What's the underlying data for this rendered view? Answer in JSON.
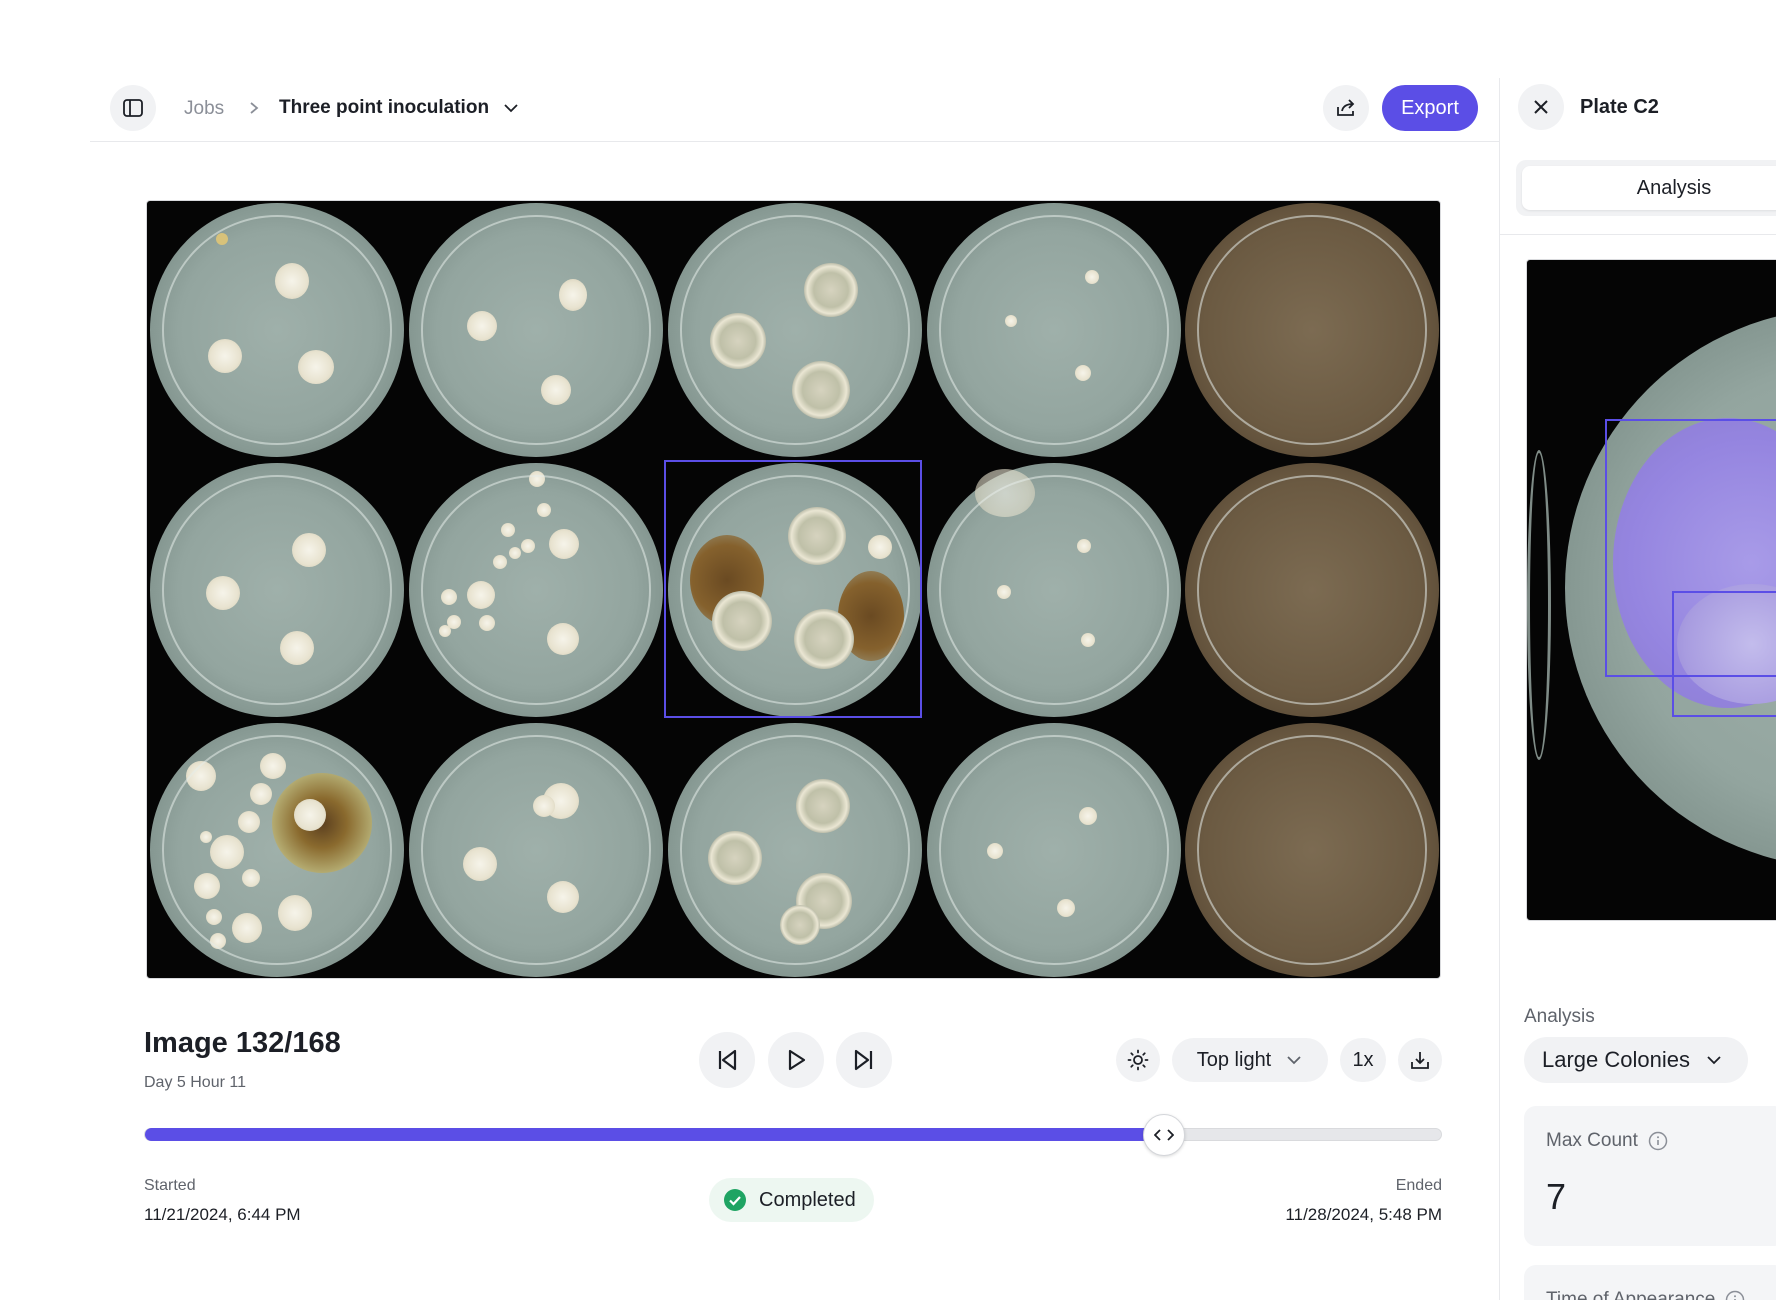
{
  "header": {
    "breadcrumb_root": "Jobs",
    "job_name": "Three point inoculation",
    "export_label": "Export"
  },
  "viewer": {
    "image_title": "Image 132/168",
    "image_subtitle": "Day 5 Hour 11",
    "light_mode": "Top light",
    "speed": "1x",
    "progress_fraction": 0.786,
    "started_label": "Started",
    "started_value": "11/21/2024, 6:44 PM",
    "ended_label": "Ended",
    "ended_value": "11/28/2024, 5:48 PM",
    "status": "Completed"
  },
  "panel": {
    "plate_title": "Plate C2",
    "tab_analysis": "Analysis",
    "analysis_label": "Analysis",
    "analysis_value": "Large Colonies",
    "max_count_label": "Max Count",
    "max_count_value": "7",
    "time_label": "Time of Appearance"
  },
  "icons": {
    "sidebar": "sidebar-toggle-icon",
    "share": "share-icon",
    "close": "close-icon",
    "prev": "skip-back-icon",
    "play": "play-icon",
    "next": "skip-forward-icon",
    "brightness": "sun-icon",
    "download": "download-icon",
    "status": "check-circle-icon",
    "info": "info-icon"
  },
  "colors": {
    "accent": "#5b4ee6",
    "status_green": "#1fa463"
  }
}
